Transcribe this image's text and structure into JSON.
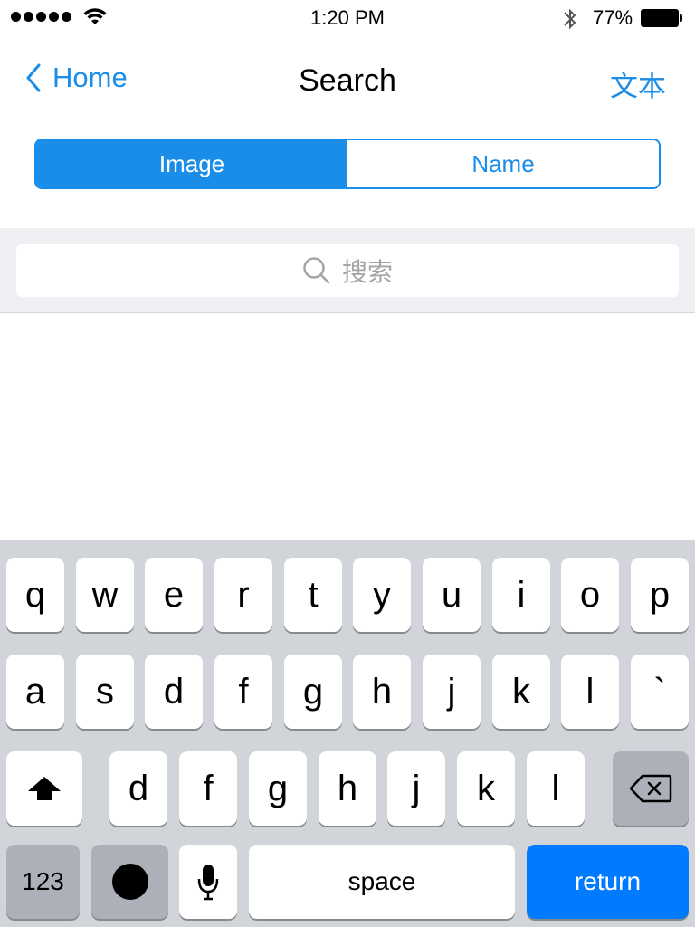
{
  "status_bar": {
    "time": "1:20 PM",
    "battery_percent": "77%"
  },
  "nav": {
    "back_label": "Home",
    "title": "Search",
    "right_label": "文本"
  },
  "segmented": {
    "options": [
      "Image",
      "Name"
    ],
    "selected": "Image"
  },
  "search": {
    "placeholder": "搜索"
  },
  "keyboard": {
    "row1": [
      "q",
      "w",
      "e",
      "r",
      "t",
      "y",
      "u",
      "i",
      "o",
      "p"
    ],
    "row2": [
      "a",
      "s",
      "d",
      "f",
      "g",
      "h",
      "j",
      "k",
      "l",
      "`"
    ],
    "row3": [
      "d",
      "f",
      "g",
      "h",
      "j",
      "k",
      "l"
    ],
    "numbers_label": "123",
    "space_label": "space",
    "return_label": "return"
  },
  "colors": {
    "accent": "#1a8de8",
    "return_key": "#007aff",
    "keyboard_bg": "#d1d4d9"
  }
}
